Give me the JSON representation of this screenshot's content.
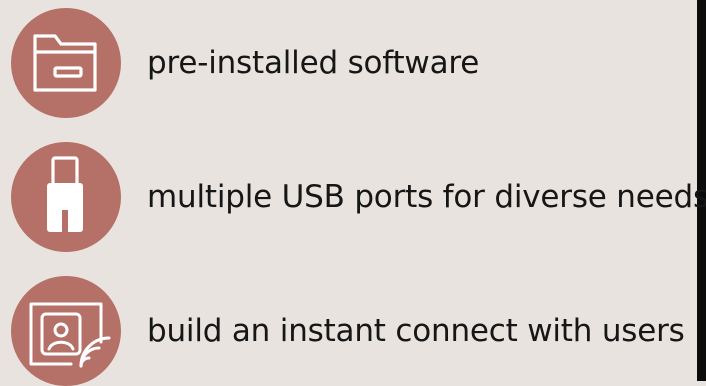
{
  "features": [
    {
      "icon": "folder-icon",
      "label": "pre-installed software"
    },
    {
      "icon": "usb-drive-icon",
      "label": "multiple USB ports for diverse needs"
    },
    {
      "icon": "screen-share-user-icon",
      "label": "build an instant connect with users"
    }
  ],
  "colors": {
    "background": "#e8e3df",
    "circle": "#b57168",
    "icon_stroke": "#ffffff",
    "text": "#161616",
    "right_bar": "#0c0c0c"
  }
}
